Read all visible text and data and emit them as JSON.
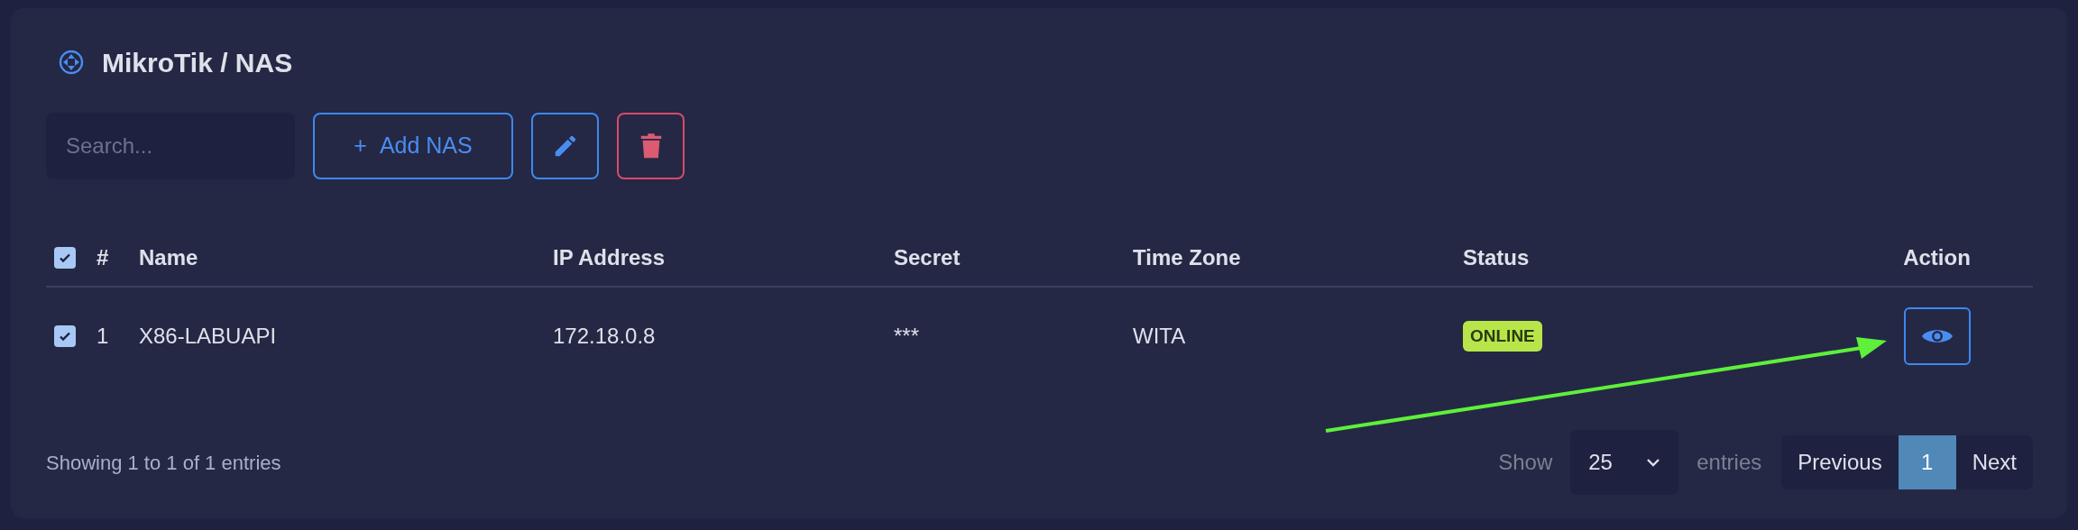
{
  "title": "MikroTik / NAS",
  "toolbar": {
    "search": {
      "placeholder": "Search..."
    },
    "add_button": {
      "icon": "+",
      "label": "Add NAS"
    }
  },
  "table": {
    "select_all_checked": true,
    "columns": [
      "#",
      "Name",
      "IP Address",
      "Secret",
      "Time Zone",
      "Status",
      "Action"
    ],
    "rows": [
      {
        "checked": true,
        "number": "1",
        "name": "X86-LABUAPI",
        "ip": "172.18.0.8",
        "secret": "***",
        "time_zone": "WITA",
        "status": "ONLINE"
      }
    ]
  },
  "footer": {
    "info": "Showing 1 to 1 of 1 entries",
    "show_label": "Show",
    "page_size": "25",
    "entries_label": "entries",
    "pagination": [
      {
        "label": "Previous",
        "selected": false
      },
      {
        "label": "1",
        "selected": true
      },
      {
        "label": "Next",
        "selected": false
      }
    ]
  }
}
